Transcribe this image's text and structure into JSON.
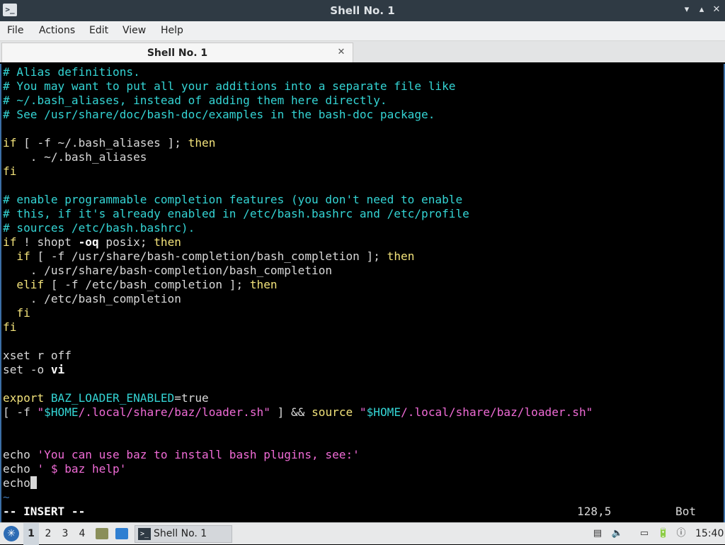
{
  "window": {
    "title": "Shell No. 1",
    "app_icon": ">_",
    "buttons": {
      "minimize": "▾",
      "maximize": "▴",
      "close": "✕"
    }
  },
  "menu": [
    "File",
    "Actions",
    "Edit",
    "View",
    "Help"
  ],
  "tab": {
    "label": "Shell No. 1",
    "close": "✕"
  },
  "terminal": {
    "lines": [
      [
        [
          "comment",
          "# Alias definitions."
        ]
      ],
      [
        [
          "comment",
          "# You may want to put all your additions into a separate file like"
        ]
      ],
      [
        [
          "comment",
          "# ~/.bash_aliases, instead of adding them here directly."
        ]
      ],
      [
        [
          "comment",
          "# See /usr/share/doc/bash-doc/examples in the bash-doc package."
        ]
      ],
      [],
      [
        [
          "yellow",
          "if"
        ],
        [
          "normal",
          " [ -f ~/.bash_aliases ]; "
        ],
        [
          "yellow",
          "then"
        ]
      ],
      [
        [
          "normal",
          "    . ~/.bash_aliases"
        ]
      ],
      [
        [
          "yellow",
          "fi"
        ]
      ],
      [],
      [
        [
          "comment",
          "# enable programmable completion features (you don't need to enable"
        ]
      ],
      [
        [
          "comment",
          "# this, if it's already enabled in /etc/bash.bashrc and /etc/profile"
        ]
      ],
      [
        [
          "comment",
          "# sources /etc/bash.bashrc)."
        ]
      ],
      [
        [
          "yellow",
          "if"
        ],
        [
          "normal",
          " ! shopt "
        ],
        [
          "bold",
          "-oq"
        ],
        [
          "normal",
          " posix; "
        ],
        [
          "yellow",
          "then"
        ]
      ],
      [
        [
          "normal",
          "  "
        ],
        [
          "yellow",
          "if"
        ],
        [
          "normal",
          " [ -f /usr/share/bash-completion/bash_completion ]; "
        ],
        [
          "yellow",
          "then"
        ]
      ],
      [
        [
          "normal",
          "    . /usr/share/bash-completion/bash_completion"
        ]
      ],
      [
        [
          "normal",
          "  "
        ],
        [
          "yellow",
          "elif"
        ],
        [
          "normal",
          " [ -f /etc/bash_completion ]; "
        ],
        [
          "yellow",
          "then"
        ]
      ],
      [
        [
          "normal",
          "    . /etc/bash_completion"
        ]
      ],
      [
        [
          "normal",
          "  "
        ],
        [
          "yellow",
          "fi"
        ]
      ],
      [
        [
          "yellow",
          "fi"
        ]
      ],
      [],
      [
        [
          "normal",
          "xset r off"
        ]
      ],
      [
        [
          "normal",
          "set -o "
        ],
        [
          "bold",
          "vi"
        ]
      ],
      [],
      [
        [
          "yellow",
          "export"
        ],
        [
          "normal",
          " "
        ],
        [
          "export",
          "BAZ_LOADER_ENABLED"
        ],
        [
          "normal",
          "=true"
        ]
      ],
      [
        [
          "normal",
          "[ -f "
        ],
        [
          "string",
          "\""
        ],
        [
          "var",
          "$HOME"
        ],
        [
          "string",
          "/.local/share/baz/loader.sh\""
        ],
        [
          "normal",
          " ] && "
        ],
        [
          "yellow",
          "source"
        ],
        [
          "normal",
          " "
        ],
        [
          "string",
          "\""
        ],
        [
          "var",
          "$HOME"
        ],
        [
          "string",
          "/.local/share/baz/loader.sh\""
        ]
      ],
      [],
      [],
      [
        [
          "normal",
          "echo "
        ],
        [
          "string",
          "'You can use baz to install bash plugins, see:'"
        ]
      ],
      [
        [
          "normal",
          "echo "
        ],
        [
          "string",
          "' $ baz help'"
        ]
      ],
      [
        [
          "normal",
          "echo"
        ],
        [
          "cursor",
          ""
        ]
      ],
      [
        [
          "tilde",
          "~"
        ]
      ]
    ],
    "mode": "-- INSERT --",
    "position": "128,5",
    "scroll": "Bot"
  },
  "taskbar": {
    "start_icon": "✳",
    "workspaces": [
      "1",
      "2",
      "3",
      "4"
    ],
    "active_workspace": "1",
    "task_icon": ">_",
    "task_label": "Shell No. 1",
    "tray_icons": {
      "clipboard": "▤",
      "volume": "🔈",
      "network": "▭",
      "battery": "🔋",
      "notify": "ⓘ"
    },
    "clock": "15:40"
  }
}
